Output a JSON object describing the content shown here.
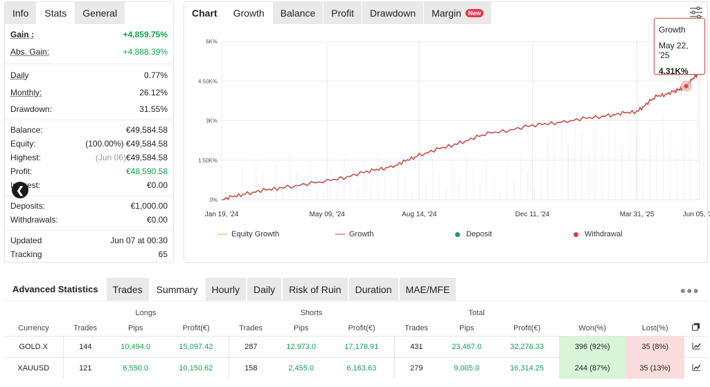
{
  "left_tabs": [
    "Info",
    "Stats",
    "General"
  ],
  "stats": {
    "gain": {
      "label": "Gain :",
      "value": "+4,859.75%"
    },
    "abs_gain": {
      "label": "Abs. Gain:",
      "value": "+4,888.39%"
    },
    "daily": {
      "label": "Daily",
      "value": "0.77%"
    },
    "monthly": {
      "label": "Monthly:",
      "value": "26.12%"
    },
    "drawdown": {
      "label": "Drawdown:",
      "value": "31.55%"
    },
    "balance": {
      "label": "Balance:",
      "value": "€49,584.58"
    },
    "equity": {
      "label": "Equity:",
      "prefix": "(100.00%)",
      "value": "€49,584.58"
    },
    "highest": {
      "label": "Highest:",
      "prefix": "(Jun 06)",
      "value": "€49,584.58"
    },
    "profit": {
      "label": "Profit:",
      "value": "€48,590.58"
    },
    "interest": {
      "label": "Interest:",
      "value": "€0.00"
    },
    "deposits": {
      "label": "Deposits:",
      "value": "€1,000.00"
    },
    "withdrawals": {
      "label": "Withdrawals:",
      "value": "€0.00"
    },
    "updated": {
      "label": "Updated",
      "value": "Jun 07 at 00:30"
    },
    "tracking": {
      "label": "Tracking",
      "value": "65"
    }
  },
  "chart_tabs": {
    "chart": "Chart",
    "growth": "Growth",
    "balance": "Balance",
    "profit": "Profit",
    "drawdown": "Drawdown",
    "margin": "Margin",
    "new_badge": "New"
  },
  "tooltip": {
    "series": "Growth",
    "date": "May 22, '25",
    "value": "4.31K%"
  },
  "legend": {
    "equity_growth": "Equity Growth",
    "growth": "Growth",
    "deposit": "Deposit",
    "withdrawal": "Withdrawal"
  },
  "colors": {
    "growth": "#c0504d",
    "equity": "#e8d9a0",
    "deposit": "#12a14b",
    "withdrawal": "#d9403a",
    "gain_green": "#12a14b"
  },
  "chart_data": {
    "type": "line",
    "x_tick_labels": [
      "Jan 19, '24",
      "May 09, '24",
      "Aug 14, '24",
      "Dec 11, '24",
      "Mar 31, '25",
      "Jun 05, '25"
    ],
    "y_tick_labels": [
      "0%",
      "1.50K%",
      "3K%",
      "4.50K%",
      "6K%"
    ],
    "ylim": [
      0,
      6000
    ],
    "series": [
      {
        "name": "Growth",
        "x": [
          "2024-01-19",
          "2024-02-15",
          "2024-03-20",
          "2024-05-09",
          "2024-06-20",
          "2024-07-20",
          "2024-08-14",
          "2024-09-20",
          "2024-10-25",
          "2024-12-11",
          "2025-01-20",
          "2025-03-01",
          "2025-03-31",
          "2025-04-20",
          "2025-05-10",
          "2025-05-22",
          "2025-06-05"
        ],
        "y": [
          0,
          250,
          450,
          700,
          1050,
          1300,
          1700,
          2100,
          2500,
          2800,
          3000,
          3200,
          3350,
          3900,
          4100,
          4310,
          4860
        ]
      }
    ]
  },
  "advanced": {
    "title": "Advanced Statistics",
    "tabs": [
      "Trades",
      "Summary",
      "Hourly",
      "Daily",
      "Risk of Ruin",
      "Duration",
      "MAE/MFE"
    ],
    "groups": [
      "Longs",
      "Shorts",
      "Total"
    ],
    "columns": [
      "Currency",
      "Trades",
      "Pips",
      "Profit(€)",
      "Trades",
      "Pips",
      "Profit(€)",
      "Trades",
      "Pips",
      "Profit(€)",
      "Won(%)",
      "Lost(%)"
    ],
    "rows": [
      [
        "GOLD.X",
        "144",
        "10,494.0",
        "15,097.42",
        "287",
        "12,973.0",
        "17,178.91",
        "431",
        "23,467.0",
        "32,276.33",
        "396 (92%)",
        "35 (8%)"
      ],
      [
        "XAUUSD",
        "121",
        "6,550.0",
        "10,150.62",
        "158",
        "2,455.0",
        "6,163.63",
        "279",
        "9,005.0",
        "16,314.25",
        "244 (87%)",
        "35 (13%)"
      ]
    ]
  }
}
